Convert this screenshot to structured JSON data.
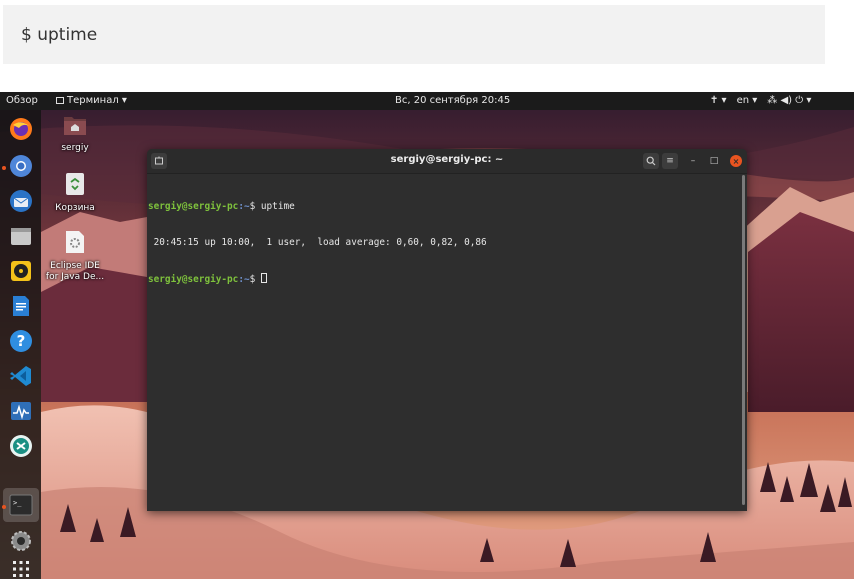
{
  "article": {
    "command": "$ uptime"
  },
  "topbar": {
    "activities": "Обзор",
    "app_menu": "Терминал ▾",
    "clock": "Вс, 20 сентября 20:45",
    "lang": "en ▾",
    "accessibility": "✝ ▾",
    "system": "⁂ ◀) ⏻ ▾"
  },
  "dock": {
    "items": [
      "firefox-icon",
      "chromium-icon",
      "thunderbird-icon",
      "files-icon",
      "rhythmbox-icon",
      "libreoffice-writer-icon",
      "help-icon",
      "vscode-icon",
      "system-monitor-icon",
      "xmind-icon",
      "terminal-icon",
      "settings-icon",
      "show-applications-icon"
    ]
  },
  "desktop": {
    "icons": [
      {
        "label": "sergiy"
      },
      {
        "label": "Корзина"
      },
      {
        "label_line1": "Eclipse IDE",
        "label_line2": "for Java De..."
      }
    ]
  },
  "terminal": {
    "title": "sergiy@sergiy-pc: ~",
    "menu_button": "≡",
    "minimize": "–",
    "maximize": "□",
    "close": "×",
    "lines": [
      {
        "user": "sergiy@sergiy-pc",
        "path": ":~",
        "cmd": "$ uptime"
      },
      {
        "output": " 20:45:15 up 10:00,  1 user,  load average: 0,60, 0,82, 0,86"
      },
      {
        "user": "sergiy@sergiy-pc",
        "path": ":~",
        "cmd": "$ "
      }
    ]
  },
  "colors": {
    "accent": "#e95420",
    "prompt_user": "#7ec13c",
    "prompt_path": "#6e8fc9",
    "terminal_bg": "#2e2e2e"
  }
}
